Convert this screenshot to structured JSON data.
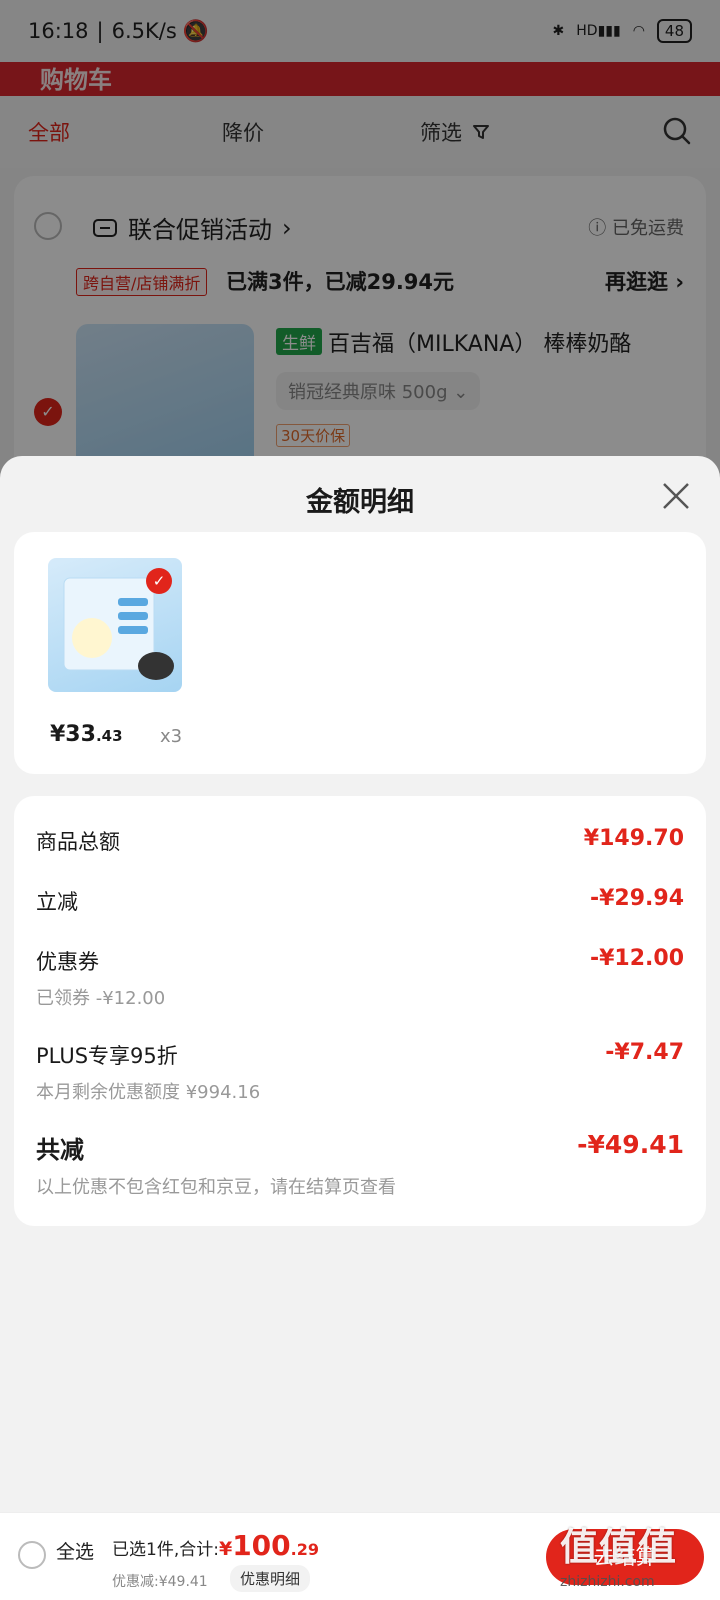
{
  "status_bar": {
    "time": "16:18",
    "speed": "6.5K/s",
    "battery": "48",
    "network": "HD"
  },
  "header": {
    "title": "购物车"
  },
  "filters": {
    "all": "全部",
    "price_drop": "降价",
    "screen": "筛选"
  },
  "cart": {
    "promo_title": "联合促销活动",
    "free_shipping": "已免运费",
    "promo_tag": "跨自营/店铺满折",
    "promo_desc": "已满3件，已减29.94元",
    "promo_more": "再逛逛",
    "fresh_tag": "生鲜",
    "product_name": "百吉福（MILKANA） 棒棒奶酪",
    "spec": "销冠经典原味 500g",
    "guarantee": "30天价保"
  },
  "sheet": {
    "title": "金额明细",
    "item": {
      "price_int": "¥33",
      "price_dec": ".43",
      "qty": "x3"
    },
    "rows": [
      {
        "label": "商品总额",
        "amount": "¥149.70",
        "sub": ""
      },
      {
        "label": "立减",
        "amount": "-¥29.94",
        "sub": ""
      },
      {
        "label": "优惠券",
        "amount": "-¥12.00",
        "sub": "已领券 -¥12.00"
      },
      {
        "label": "PLUS专享95折",
        "amount": "-¥7.47",
        "sub": "本月剩余优惠额度 ¥994.16"
      }
    ],
    "total": {
      "label": "共减",
      "amount": "-¥49.41",
      "note": "以上优惠不包含红包和京豆，请在结算页查看"
    }
  },
  "bottom_bar": {
    "select_all": "全选",
    "selected_text": "已选1件,合计:",
    "currency": "¥",
    "total_int": "100",
    "total_dec": ".29",
    "discount": "优惠减:¥49.41",
    "detail_button": "优惠明细",
    "checkout": "去结算"
  },
  "watermark": {
    "main": "值值值",
    "sub": "zhizhizhi.com"
  },
  "colors": {
    "accent": "#e1251b",
    "fresh": "#21a84b"
  }
}
